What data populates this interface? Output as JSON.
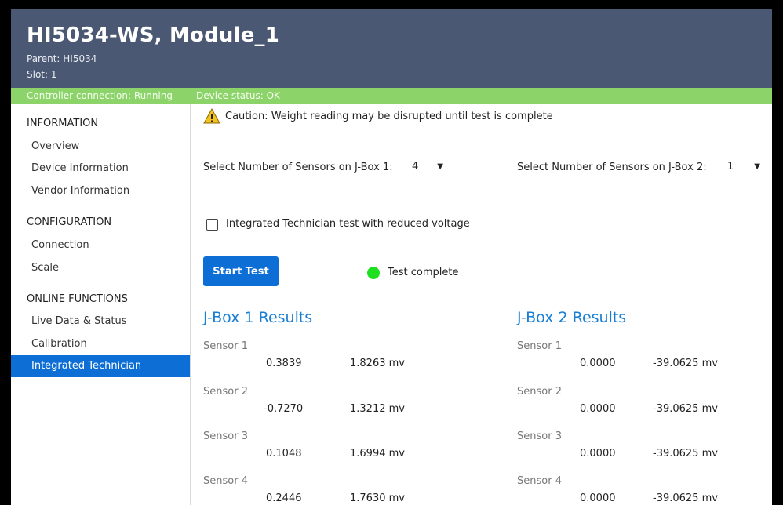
{
  "header": {
    "title": "HI5034-WS, Module_1",
    "parent": "Parent: HI5034",
    "slot": "Slot: 1"
  },
  "status": {
    "connection": "Controller connection: Running",
    "device": "Device status: OK"
  },
  "sidebar": {
    "sections": [
      {
        "title": "INFORMATION",
        "items": [
          "Overview",
          "Device Information",
          "Vendor Information"
        ]
      },
      {
        "title": "CONFIGURATION",
        "items": [
          "Connection",
          "Scale"
        ]
      },
      {
        "title": "ONLINE FUNCTIONS",
        "items": [
          "Live Data & Status",
          "Calibration",
          "Integrated Technician"
        ]
      }
    ],
    "active_item": "Integrated Technician"
  },
  "main": {
    "caution": "Caution: Weight reading may be disrupted until test is complete",
    "jbox1_select": {
      "label": "Select Number of Sensors on J-Box 1:",
      "value": "4"
    },
    "jbox2_select": {
      "label": "Select Number of Sensors on J-Box 2:",
      "value": "1"
    },
    "reduced_voltage": {
      "label": "Integrated Technician test with reduced voltage",
      "checked": false
    },
    "start_button": "Start Test",
    "test_status": "Test complete",
    "test_status_color": "#1ee01e",
    "results": [
      {
        "title": "J-Box 1 Results",
        "sensors": [
          {
            "name": "Sensor 1",
            "value": "0.3839",
            "mv": "1.8263 mv"
          },
          {
            "name": "Sensor 2",
            "value": "-0.7270",
            "mv": "1.3212 mv"
          },
          {
            "name": "Sensor 3",
            "value": "0.1048",
            "mv": "1.6994 mv"
          },
          {
            "name": "Sensor 4",
            "value": "0.2446",
            "mv": "1.7630 mv"
          }
        ]
      },
      {
        "title": "J-Box 2 Results",
        "sensors": [
          {
            "name": "Sensor 1",
            "value": "0.0000",
            "mv": "-39.0625 mv"
          },
          {
            "name": "Sensor 2",
            "value": "0.0000",
            "mv": "-39.0625 mv"
          },
          {
            "name": "Sensor 3",
            "value": "0.0000",
            "mv": "-39.0625 mv"
          },
          {
            "name": "Sensor 4",
            "value": "0.0000",
            "mv": "-39.0625 mv"
          }
        ]
      }
    ]
  },
  "colors": {
    "header_bg": "#4a5873",
    "status_bg": "#8cd46a",
    "accent": "#0d6fd6",
    "results_title": "#1a7fd4"
  }
}
